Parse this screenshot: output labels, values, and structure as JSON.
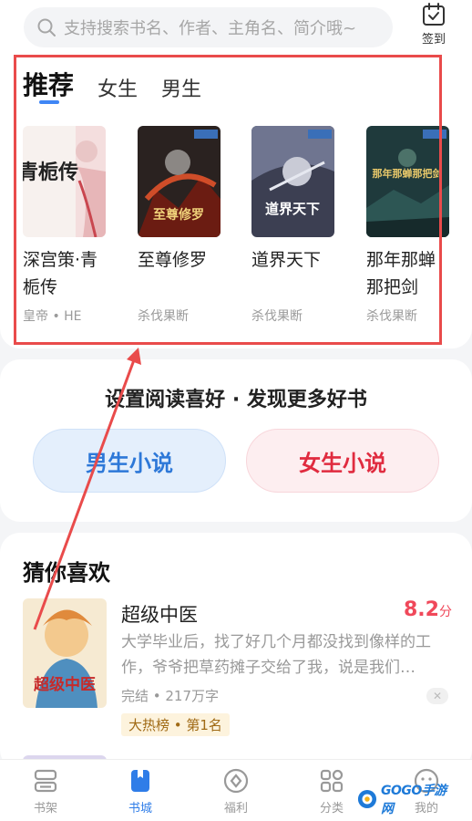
{
  "search": {
    "placeholder": "支持搜索书名、作者、主角名、简介哦~"
  },
  "checkin": {
    "label": "签到"
  },
  "recommend": {
    "tabs": [
      {
        "label": "推荐",
        "active": true
      },
      {
        "label": "女生",
        "active": false
      },
      {
        "label": "男生",
        "active": false
      }
    ],
    "books": [
      {
        "title": "深宫策·青栀传",
        "meta": "皇帝 • HE",
        "cover_text": "青栀传"
      },
      {
        "title": "至尊修罗",
        "meta": "杀伐果断",
        "cover_text": "至尊修罗"
      },
      {
        "title": "道界天下",
        "meta": "杀伐果断",
        "cover_text": "道界天下"
      },
      {
        "title": "那年那蝉那把剑",
        "meta": "杀伐果断",
        "cover_text": "那年那蝉那把剑"
      }
    ]
  },
  "preference": {
    "title": "设置阅读喜好 · 发现更多好书",
    "male_label": "男生小说",
    "female_label": "女生小说"
  },
  "guess": {
    "title": "猜你喜欢",
    "book": {
      "title": "超级中医",
      "score": "8.2",
      "score_unit": "分",
      "description": "大学毕业后，找了好几个月都没找到像样的工作，爷爷把草药摊子交给了我，说是我们…",
      "status": "完结 • 217万字",
      "rank": "大热榜 • 第1名",
      "cover_text": "超级中医"
    }
  },
  "nav": [
    {
      "label": "书架",
      "icon": "bookshelf-icon",
      "active": false
    },
    {
      "label": "书城",
      "icon": "bookstore-icon",
      "active": true
    },
    {
      "label": "福利",
      "icon": "welfare-icon",
      "active": false
    },
    {
      "label": "分类",
      "icon": "category-icon",
      "active": false
    },
    {
      "label": "我的",
      "icon": "profile-icon",
      "active": false
    }
  ],
  "watermark": {
    "text": "GOGO手游网"
  },
  "colors": {
    "accent": "#2f7de8",
    "annotation": "#e94b4b",
    "score": "#f0485a"
  }
}
